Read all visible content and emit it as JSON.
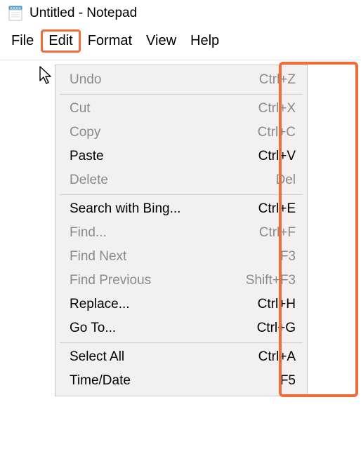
{
  "window": {
    "title": "Untitled - Notepad"
  },
  "menubar": {
    "items": [
      {
        "label": "File",
        "selected": false
      },
      {
        "label": "Edit",
        "selected": true
      },
      {
        "label": "Format",
        "selected": false
      },
      {
        "label": "View",
        "selected": false
      },
      {
        "label": "Help",
        "selected": false
      }
    ]
  },
  "dropdown": {
    "groups": [
      [
        {
          "label": "Undo",
          "shortcut": "Ctrl+Z",
          "enabled": false
        }
      ],
      [
        {
          "label": "Cut",
          "shortcut": "Ctrl+X",
          "enabled": false
        },
        {
          "label": "Copy",
          "shortcut": "Ctrl+C",
          "enabled": false
        },
        {
          "label": "Paste",
          "shortcut": "Ctrl+V",
          "enabled": true
        },
        {
          "label": "Delete",
          "shortcut": "Del",
          "enabled": false
        }
      ],
      [
        {
          "label": "Search with Bing...",
          "shortcut": "Ctrl+E",
          "enabled": true
        },
        {
          "label": "Find...",
          "shortcut": "Ctrl+F",
          "enabled": false
        },
        {
          "label": "Find Next",
          "shortcut": "F3",
          "enabled": false
        },
        {
          "label": "Find Previous",
          "shortcut": "Shift+F3",
          "enabled": false
        },
        {
          "label": "Replace...",
          "shortcut": "Ctrl+H",
          "enabled": true
        },
        {
          "label": "Go To...",
          "shortcut": "Ctrl+G",
          "enabled": true
        }
      ],
      [
        {
          "label": "Select All",
          "shortcut": "Ctrl+A",
          "enabled": true
        },
        {
          "label": "Time/Date",
          "shortcut": "F5",
          "enabled": true
        }
      ]
    ]
  },
  "annotation": {
    "highlight_color": "#f26b3a"
  }
}
